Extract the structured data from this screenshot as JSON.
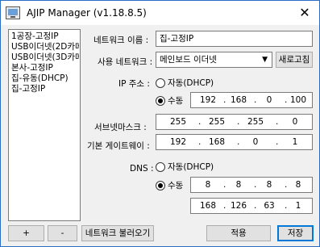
{
  "window": {
    "title": "AJIP Manager (v1.18.8.5)",
    "close_glyph": "✕"
  },
  "profiles": {
    "items": [
      "1공장-고정IP",
      "USB이더넷(2D카메라",
      "USB이더넷(3D카메라",
      "본사-고정IP",
      "집-유동(DHCP)",
      "집-고정IP"
    ]
  },
  "bottom": {
    "add_label": "+",
    "remove_label": "-",
    "load_label": "네트워크 불러오기",
    "apply_label": "적용",
    "save_label": "저장"
  },
  "form": {
    "network_name_label": "네트워크 이름 :",
    "network_name_value": "집-고정IP",
    "adapter_label": "사용 네트워크 :",
    "adapter_value": "메인보드 이더넷",
    "refresh_label": "새로고침",
    "ip_label": "IP 주소 :",
    "ip_auto_label": "자동(DHCP)",
    "ip_manual_label": "수동",
    "ip_address": [
      "192",
      "168",
      "0",
      "100"
    ],
    "subnet_label": "서브넷마스크 :",
    "subnet_mask": [
      "255",
      "255",
      "255",
      "0"
    ],
    "gateway_label": "기본 게이트웨이 :",
    "gateway": [
      "192",
      "168",
      "0",
      "1"
    ],
    "dns_label": "DNS :",
    "dns_auto_label": "자동(DHCP)",
    "dns_manual_label": "수동",
    "dns_primary": [
      "8",
      "8",
      "8",
      "8"
    ],
    "dns_secondary": [
      "168",
      "126",
      "63",
      "1"
    ],
    "ip_mode": "manual",
    "dns_mode": "manual"
  }
}
